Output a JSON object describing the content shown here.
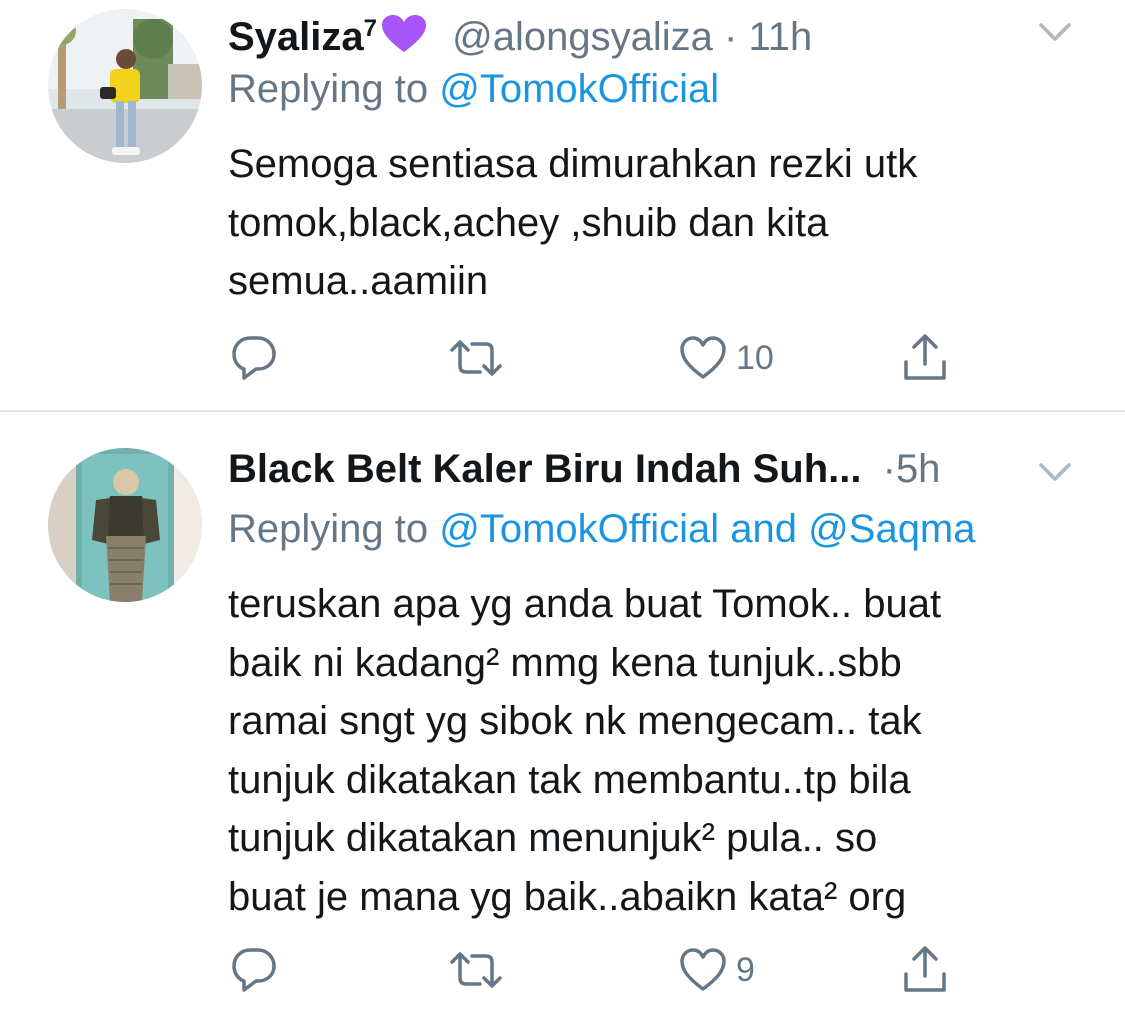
{
  "tweets": [
    {
      "display_name": "Syaliza",
      "name_superscript": "7",
      "name_emoji": "purple-heart",
      "handle": "@alongsyaliza",
      "separator": "·",
      "time": "11h",
      "replying_prefix": "Replying to ",
      "replying_to": [
        "@TomokOfficial"
      ],
      "text": "Semoga sentiasa dimurahkan rezki utk\ntomok,black,achey ,shuib dan kita\nsemua..aamiin",
      "like_count": "10",
      "icons": {
        "menu": "chevron-down-icon",
        "reply": "reply-icon",
        "retweet": "retweet-icon",
        "like": "heart-icon",
        "share": "share-icon"
      }
    },
    {
      "display_name": "Black Belt Kaler Biru Indah Suh...",
      "separator": "·",
      "time": "5h",
      "replying_prefix": "Replying to ",
      "replying_to": [
        "@TomokOfficial",
        "@Saqma"
      ],
      "replying_joiner": " and ",
      "text": "teruskan apa yg anda buat Tomok.. buat\nbaik ni kadang² mmg kena tunjuk..sbb\nramai sngt yg sibok nk mengecam.. tak\ntunjuk dikatakan tak membantu..tp bila\ntunjuk dikatakan menunjuk² pula.. so\nbuat je mana yg baik..abaikn kata² org",
      "like_count": "9",
      "icons": {
        "menu": "chevron-down-icon",
        "reply": "reply-icon",
        "retweet": "retweet-icon",
        "like": "heart-icon",
        "share": "share-icon"
      }
    }
  ],
  "colors": {
    "text_primary": "#14171a",
    "text_secondary": "#657786",
    "link": "#1b95e0",
    "divider": "#e1e8ed",
    "emoji_heart": "#a855f7"
  }
}
